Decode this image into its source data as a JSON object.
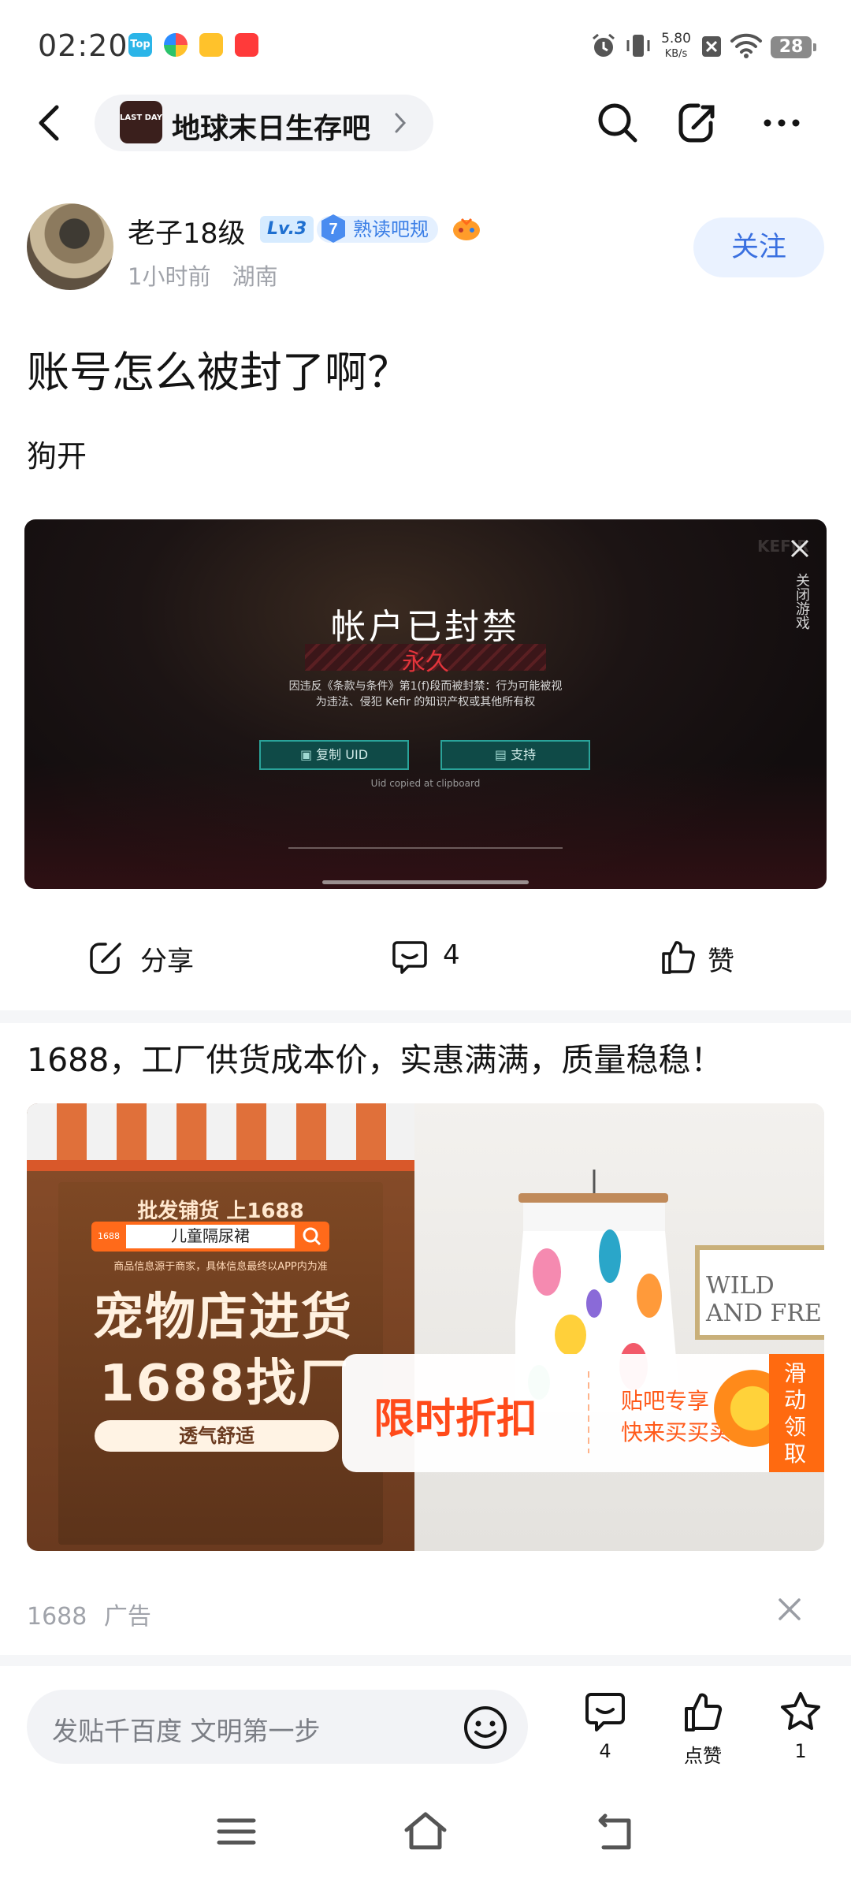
{
  "status_bar": {
    "time": "02:20",
    "app_icons": [
      "top-app-icon",
      "browser-app-icon",
      "mail-app-icon",
      "shopping-app-icon"
    ],
    "net_speed_value": "5.80",
    "net_speed_unit": "KB/s",
    "battery": "28"
  },
  "nav": {
    "forum_logo_text": "LAST DAY",
    "forum_name": "地球末日生存吧"
  },
  "author": {
    "name": "老子18级",
    "level": "Lv.3",
    "title_number": "7",
    "title": "熟读吧规",
    "time": "1小时前",
    "location": "湖南",
    "follow_label": "关注"
  },
  "post": {
    "title": "账号怎么被封了啊？",
    "body": "狗开",
    "image": {
      "brand": "KEFIR",
      "close_label": "关闭游戏",
      "heading": "帐户已封禁",
      "banner": "永久",
      "desc_line1": "因违反《条款与条件》第1(f)段而被封禁：行为可能被视",
      "desc_line2": "为违法、侵犯 Kefir 的知识产权或其他所有权",
      "copy_uid": "复制 UID",
      "support": "支持",
      "note": "Uid copied at clipboard"
    }
  },
  "actions": {
    "share_label": "分享",
    "comment_count": "4",
    "like_label": "赞"
  },
  "ad": {
    "title": "1688，工厂供货成本价，实惠满满，质量稳稳！",
    "img_top_text": "批发铺货 上1688",
    "img_search_logo": "1688",
    "img_search_text": "儿童隔尿裙",
    "img_small_text": "商品信息源于商家，具体信息最终以APP内为准",
    "img_big1": "宠物店进货",
    "img_big2": "1688找厂",
    "img_pill": "透气舒适",
    "img_sign": "WILD AND FRE",
    "img_discount": "限时折扣",
    "img_discount_sub1": "贴吧专享",
    "img_discount_sub2": "快来买买买",
    "img_tag": "滑动领取",
    "source": "1688",
    "source_tag": "广告"
  },
  "bottom_bar": {
    "reply_placeholder": "发贴千百度 文明第一步",
    "comment_count": "4",
    "like_label": "点赞",
    "star_count": "1"
  },
  "colors": {
    "accent_blue": "#3a70e0",
    "follow_bg": "#eaf2ff",
    "ad_orange": "#ff6a1a",
    "ban_red": "#e3343b"
  }
}
